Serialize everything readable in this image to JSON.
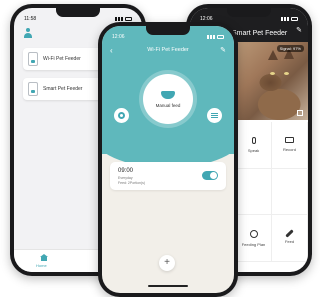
{
  "left_phone": {
    "status_time": "11:58",
    "devices": [
      {
        "label": "Wi-Fi Pet Feeder"
      },
      {
        "label": "Smart Pet Feeder"
      }
    ],
    "tabbar": {
      "home_label": "Home"
    }
  },
  "center_phone": {
    "status_time": "12:06",
    "title": "Wi-Fi Pet Feeder",
    "feed_button_label": "Manual feed",
    "schedule": {
      "time": "09:00",
      "repeat": "Everyday",
      "detail": "Feed: 2Portion(s)"
    },
    "add_symbol": "+"
  },
  "right_phone": {
    "status_time": "12:06",
    "title": "Smart Pet Feeder",
    "signal_badge": "Signal: 97%",
    "actions": [
      {
        "label": "Speak",
        "icon": "microphone-icon"
      },
      {
        "label": "Record",
        "icon": "camera-icon"
      },
      {
        "label": "",
        "icon": ""
      },
      {
        "label": "",
        "icon": ""
      },
      {
        "label": "Feeding Plan",
        "icon": "clock-icon"
      },
      {
        "label": "Feed",
        "icon": "bone-icon"
      }
    ]
  },
  "colors": {
    "accent": "#41a7b3",
    "header_teal": "#5fb8bc",
    "background_cream": "#f2efe9"
  }
}
